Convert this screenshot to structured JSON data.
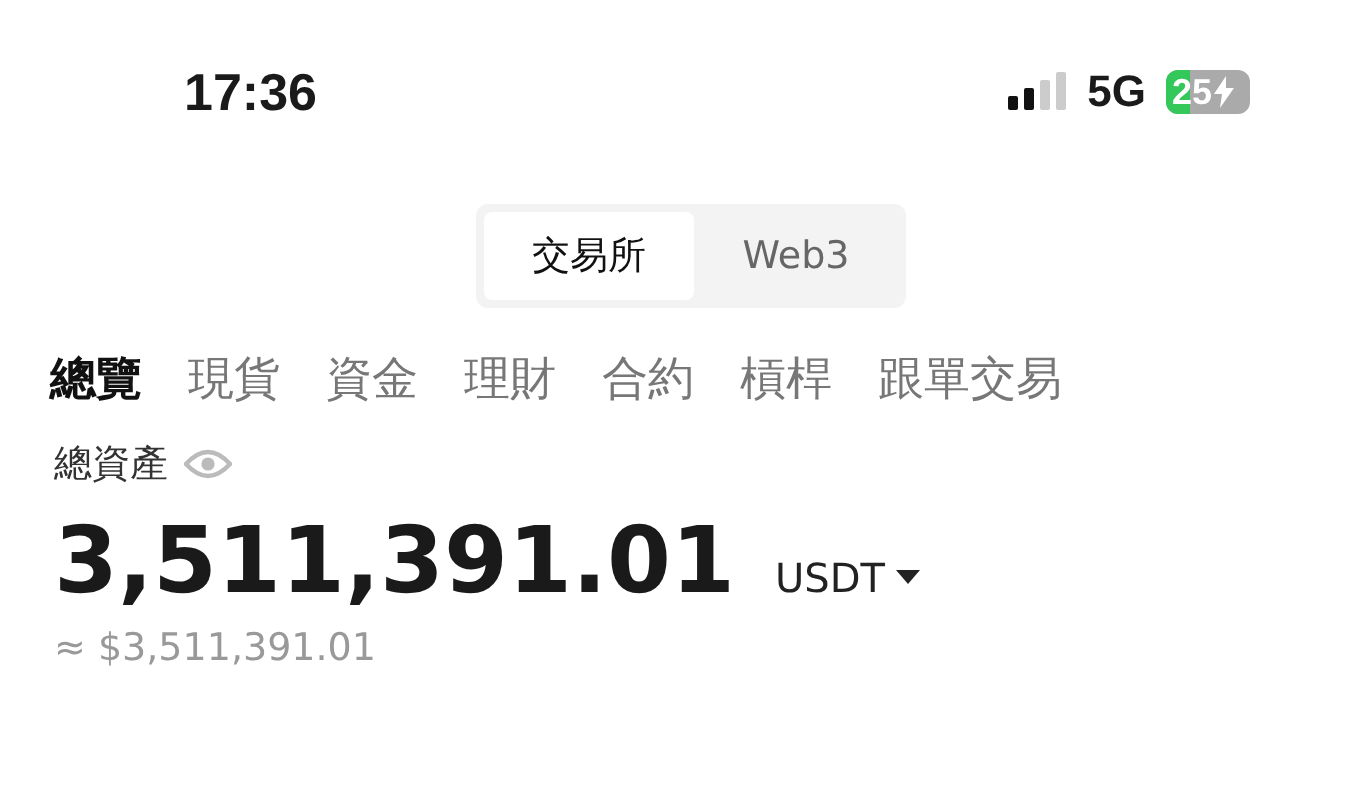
{
  "status_bar": {
    "time": "17:36",
    "network": "5G",
    "battery": "25"
  },
  "segments": [
    {
      "label": "交易所",
      "selected": true
    },
    {
      "label": "Web3",
      "selected": false
    }
  ],
  "tabs": [
    {
      "label": "總覽",
      "selected": true
    },
    {
      "label": "現貨",
      "selected": false
    },
    {
      "label": "資金",
      "selected": false
    },
    {
      "label": "理財",
      "selected": false
    },
    {
      "label": "合約",
      "selected": false
    },
    {
      "label": "槓桿",
      "selected": false
    },
    {
      "label": "跟單交易",
      "selected": false
    }
  ],
  "assets": {
    "label": "總資產",
    "amount": "3,511,391.01",
    "currency": "USDT",
    "approx": "≈ $3,511,391.01"
  }
}
